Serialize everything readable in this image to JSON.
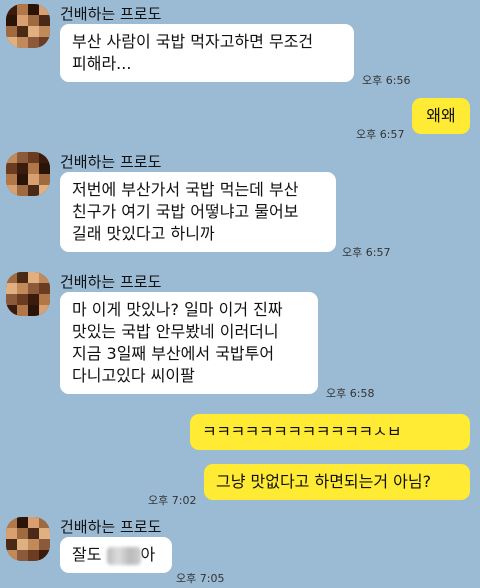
{
  "sender_name": "건배하는 프로도",
  "messages": [
    {
      "id": "m1",
      "side": "in",
      "lines": [
        "부산 사람이 국밥 먹자고하면 무조건",
        "피해라..."
      ],
      "time": "오후 6:56"
    },
    {
      "id": "m2",
      "side": "out",
      "lines": [
        "왜왜"
      ],
      "time": "오후 6:57"
    },
    {
      "id": "m3",
      "side": "in",
      "lines": [
        "저번에 부산가서 국밥 먹는데 부산",
        "친구가 여기 국밥 어떻냐고 물어보",
        "길래 맛있다고 하니까"
      ],
      "time": "오후 6:57"
    },
    {
      "id": "m4",
      "side": "in",
      "lines": [
        "마 이게 맛있나? 일마 이거 진짜",
        "맛있는 국밥 안무봤네 이러더니",
        "지금 3일째 부산에서 국밥투어",
        "다니고있다 씨이팔"
      ],
      "time": "오후 6:58"
    },
    {
      "id": "m5",
      "side": "out",
      "lines": [
        "ㅋㅋㅋㅋㅋㅋㅋㅋㅋㅋㅋㅋㅅㅂ"
      ]
    },
    {
      "id": "m6",
      "side": "out",
      "lines": [
        "그냥 맛없다고 하면되는거 아님?"
      ],
      "time": "오후 7:02"
    },
    {
      "id": "m7",
      "side": "in",
      "lines": [
        "잘도 ",
        "아"
      ],
      "time": "오후 7:05"
    }
  ],
  "colors": {
    "background": "#9bbbd4",
    "incoming": "#ffffff",
    "outgoing": "#ffeb33"
  }
}
